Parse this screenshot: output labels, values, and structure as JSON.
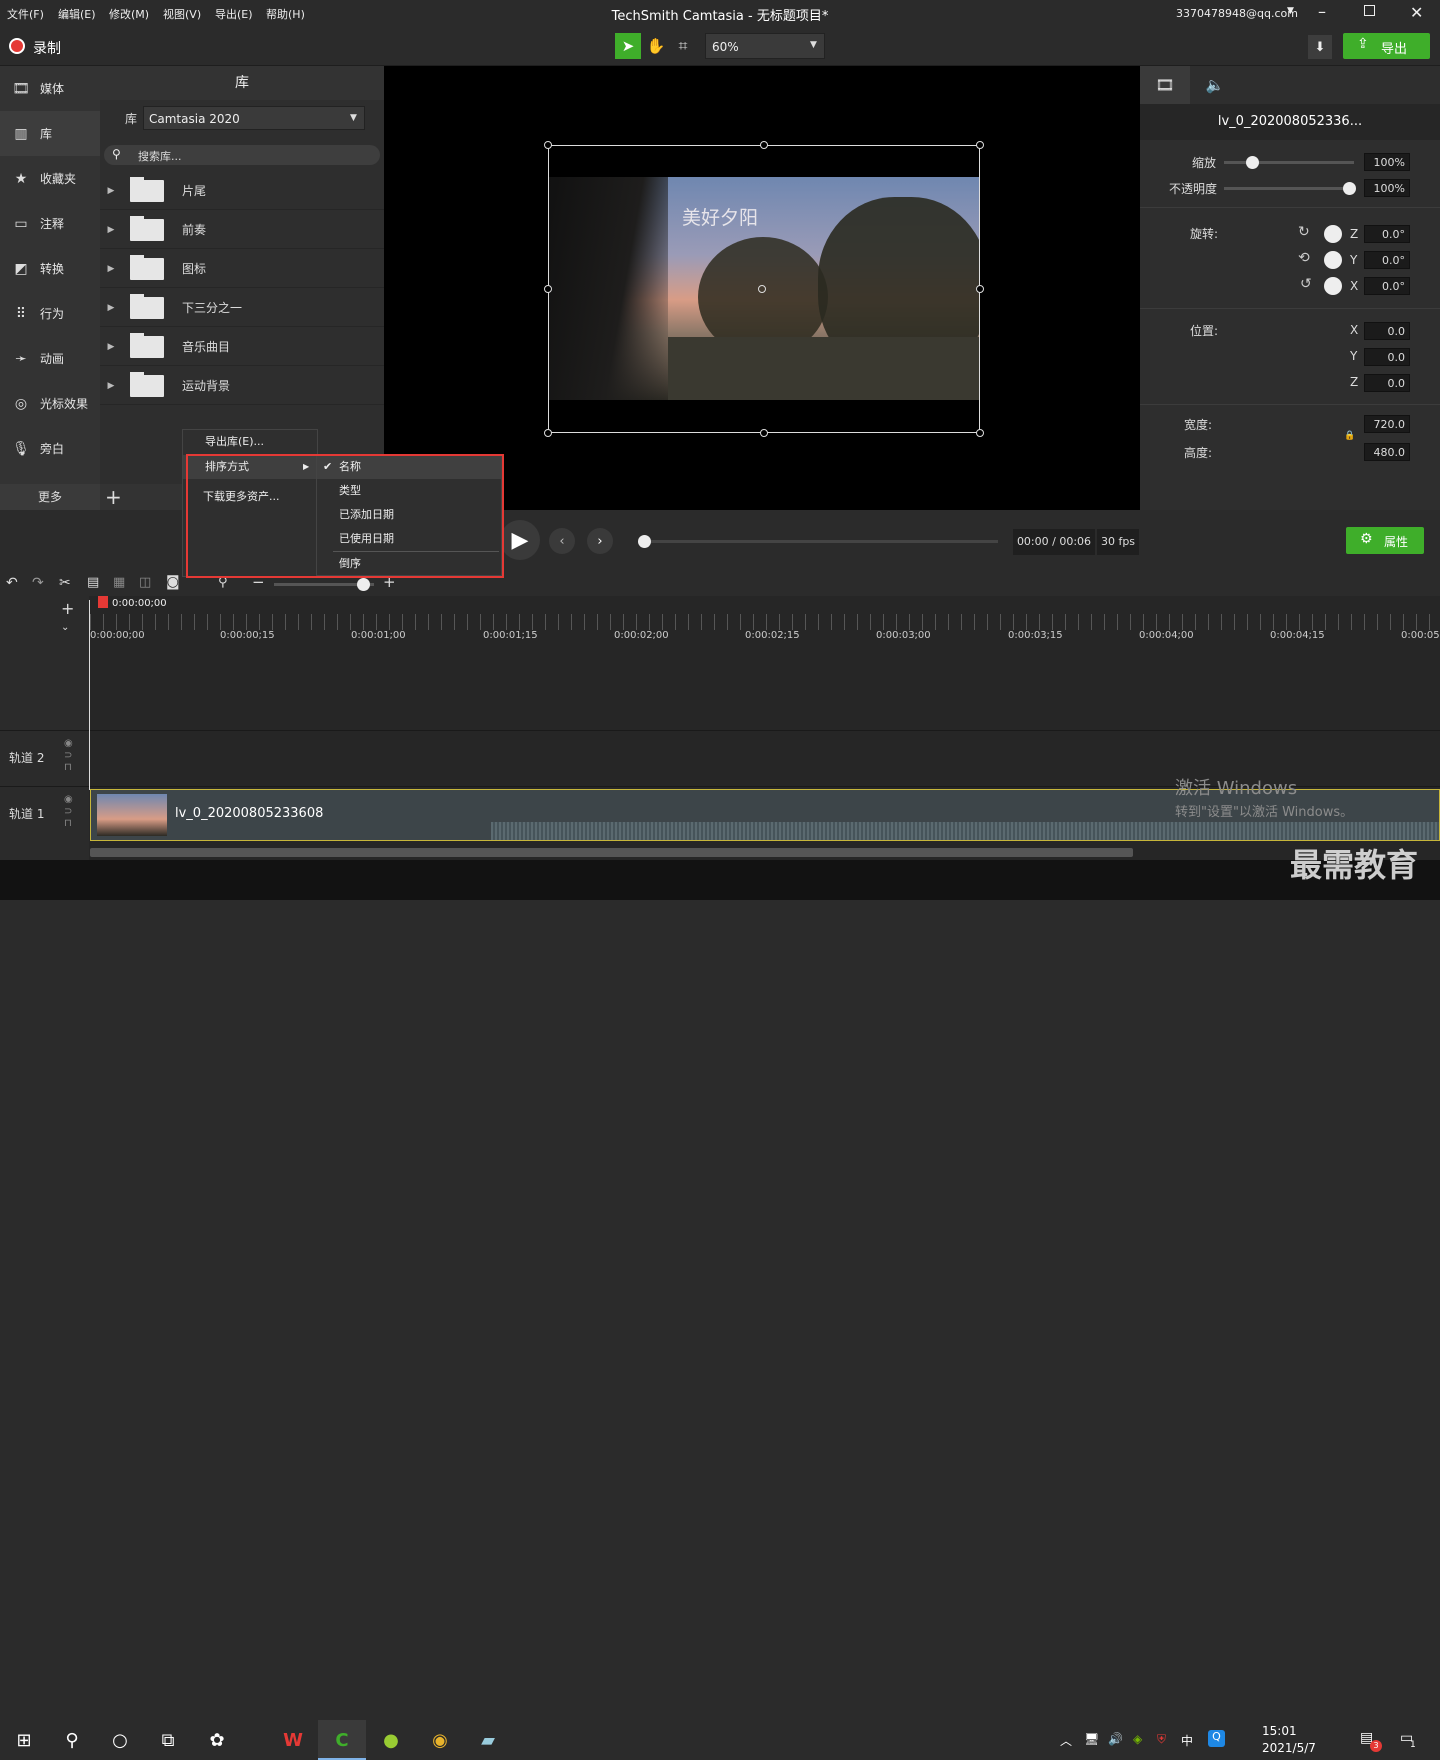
{
  "titlebar": {
    "menus": [
      "文件(F)",
      "编辑(E)",
      "修改(M)",
      "视图(V)",
      "导出(E)",
      "帮助(H)"
    ],
    "title": "TechSmith Camtasia - 无标题项目*",
    "account": "3370478948@qq.com"
  },
  "toolbar": {
    "record_label": "录制",
    "zoom": "60%",
    "export_label": "导出"
  },
  "sidenav": {
    "items": [
      "媒体",
      "库",
      "收藏夹",
      "注释",
      "转换",
      "行为",
      "动画",
      "光标效果",
      "旁白"
    ],
    "more_label": "更多"
  },
  "library": {
    "title": "库",
    "select_label": "库",
    "select_value": "Camtasia 2020",
    "search_placeholder": "搜索库...",
    "folders": [
      "片尾",
      "前奏",
      "图标",
      "下三分之一",
      "音乐曲目",
      "运动背景"
    ]
  },
  "context_menu": {
    "export_library": "导出库(E)...",
    "sort_by": "排序方式",
    "download_more": "下载更多资产...",
    "sort_options": [
      "名称",
      "类型",
      "已添加日期",
      "已使用日期",
      "倒序"
    ]
  },
  "canvas": {
    "overlay_text": "美好夕阳"
  },
  "properties": {
    "clip_name": "lv_0_202008052336...",
    "scale_label": "缩放",
    "scale_value": "100%",
    "opacity_label": "不透明度",
    "opacity_value": "100%",
    "rotation_label": "旋转:",
    "rot_z_axis": "Z",
    "rot_z": "0.0°",
    "rot_y_axis": "Y",
    "rot_y": "0.0°",
    "rot_x_axis": "X",
    "rot_x": "0.0°",
    "position_label": "位置:",
    "pos_x_axis": "X",
    "pos_x": "0.0",
    "pos_y_axis": "Y",
    "pos_y": "0.0",
    "pos_z_axis": "Z",
    "pos_z": "0.0",
    "width_label": "宽度:",
    "width_value": "720.0",
    "height_label": "高度:",
    "height_value": "480.0",
    "properties_button": "属性"
  },
  "playback": {
    "time": "00:00 / 00:06",
    "fps": "30 fps"
  },
  "timeline": {
    "playhead_time": "0:00:00;00",
    "ticks": [
      "0:00:00;00",
      "0:00:00;15",
      "0:00:01;00",
      "0:00:01;15",
      "0:00:02;00",
      "0:00:02;15",
      "0:00:03;00",
      "0:00:03;15",
      "0:00:04;00",
      "0:00:04;15",
      "0:00:05"
    ],
    "tracks": [
      "轨道 2",
      "轨道 1"
    ],
    "clip_name": "lv_0_20200805233608"
  },
  "watermark": {
    "line1": "激活 Windows",
    "line2": "转到\"设置\"以激活 Windows。",
    "brand": "最需教育"
  },
  "taskbar": {
    "ime": "中",
    "time": "15:01",
    "date": "2021/5/7",
    "notif_count": "3",
    "action_count": "1"
  },
  "colors": {
    "accent_green": "#3fae2a",
    "highlight_red": "#e53935",
    "record_red": "#e53935",
    "clip_border": "#c7b63a"
  }
}
